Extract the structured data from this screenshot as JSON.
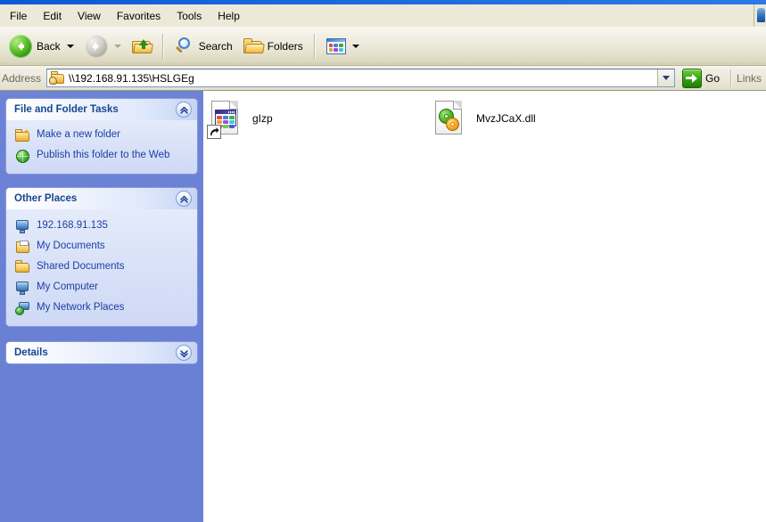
{
  "menubar": {
    "items": [
      {
        "label": "File"
      },
      {
        "label": "Edit"
      },
      {
        "label": "View"
      },
      {
        "label": "Favorites"
      },
      {
        "label": "Tools"
      },
      {
        "label": "Help"
      }
    ]
  },
  "toolbar": {
    "back_label": "Back",
    "back_icon": "back-arrow-icon",
    "forward_icon": "forward-arrow-icon",
    "up_icon": "up-folder-icon",
    "search_label": "Search",
    "search_icon": "magnifier-icon",
    "folders_label": "Folders",
    "folders_icon": "folder-icon",
    "views_icon": "views-icon"
  },
  "address": {
    "label": "Address",
    "icon": "network-share-folder-icon",
    "value": "\\\\192.168.91.135\\HSLGEg",
    "dropdown_icon": "chevron-down-icon",
    "go_label": "Go",
    "go_icon": "go-arrow-icon",
    "links_label": "Links"
  },
  "sidebar": {
    "panels": [
      {
        "title": "File and Folder Tasks",
        "collapse_icon": "chevron-up-icon",
        "collapsed": false,
        "items": [
          {
            "label": "Make a new folder",
            "icon": "new-folder-icon"
          },
          {
            "label": "Publish this folder to the Web",
            "icon": "globe-icon"
          }
        ]
      },
      {
        "title": "Other Places",
        "collapse_icon": "chevron-up-icon",
        "collapsed": false,
        "items": [
          {
            "label": "192.168.91.135",
            "icon": "computer-icon"
          },
          {
            "label": "My Documents",
            "icon": "my-documents-icon"
          },
          {
            "label": "Shared Documents",
            "icon": "shared-folder-icon"
          },
          {
            "label": "My Computer",
            "icon": "computer-icon"
          },
          {
            "label": "My Network Places",
            "icon": "network-places-icon"
          }
        ]
      },
      {
        "title": "Details",
        "collapse_icon": "chevron-down-icon",
        "collapsed": true,
        "items": []
      }
    ]
  },
  "files": [
    {
      "name": "gIzp",
      "icon": "html-document-shortcut-icon",
      "is_shortcut": true
    },
    {
      "name": "MvzJCaX.dll",
      "icon": "dll-gears-icon",
      "is_shortcut": false
    }
  ],
  "colors": {
    "sidebar_background": "#6a80d4",
    "panel_title": "#17458f",
    "link_text": "#1b3fa0",
    "toolbar_background": "#ece9d8",
    "titlebar": "#1f6fe0",
    "go_green": "#3aa615"
  }
}
